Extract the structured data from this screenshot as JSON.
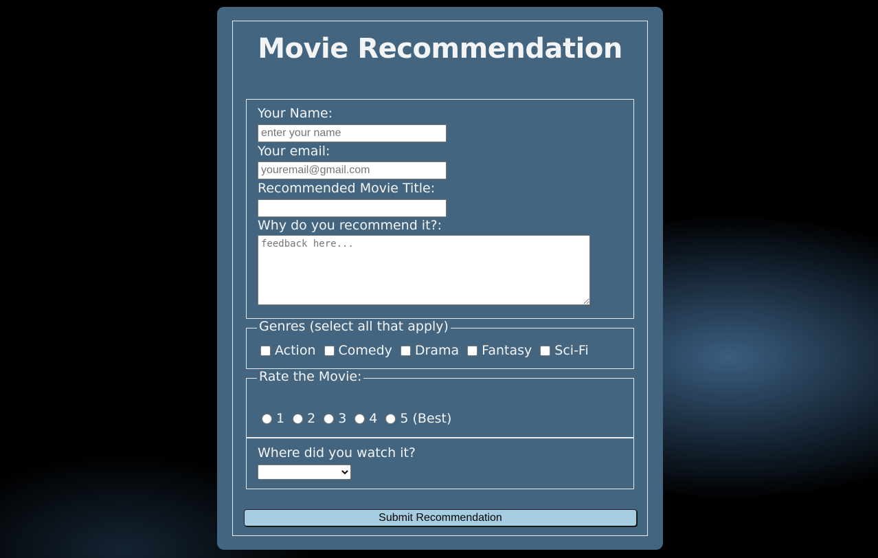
{
  "form": {
    "title": "Movie Recommendation",
    "name_label": "Your Name:",
    "name_placeholder": "enter your name",
    "email_label": "Your email:",
    "email_placeholder": "youremail@gmail.com",
    "movie_label": "Recommended Movie Title:",
    "movie_value": "",
    "why_label": "Why do you recommend it?:",
    "why_placeholder": "feedback here...",
    "genres": {
      "legend": "Genres (select all that apply)",
      "options": [
        "Action",
        "Comedy",
        "Drama",
        "Fantasy",
        "Sci-Fi"
      ]
    },
    "rating": {
      "legend": "Rate the Movie:",
      "options": [
        "1",
        "2",
        "3",
        "4",
        "5 (Best)"
      ]
    },
    "where": {
      "label": "Where did you watch it?",
      "selected": ""
    },
    "submit_label": "Submit Recommendation"
  },
  "colors": {
    "card": "#44657f",
    "submit": "#a7cde3",
    "background": "#000000"
  }
}
